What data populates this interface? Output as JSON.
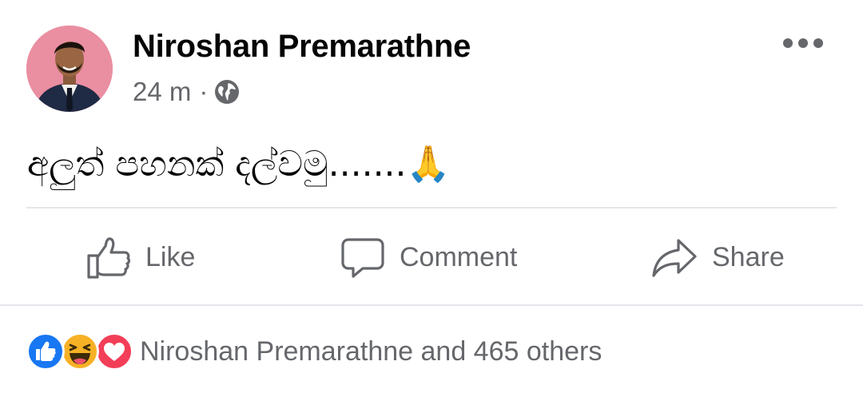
{
  "post": {
    "author": "Niroshan Premarathne",
    "time": "24 m",
    "separator": "·",
    "audience_icon": "globe-icon",
    "text": "අලුත් පහනක් දල්වමු.......",
    "emoji": "🙏"
  },
  "actions": {
    "like": "Like",
    "comment": "Comment",
    "share": "Share"
  },
  "reactions": {
    "icons": [
      "like-reaction-icon",
      "haha-reaction-icon",
      "love-reaction-icon"
    ],
    "summary": "Niroshan Premarathne and 465 others"
  },
  "colors": {
    "text_primary": "#050505",
    "text_secondary": "#65676b",
    "like_blue": "#1877f2",
    "love_red": "#f33e58",
    "haha_yellow": "#f7b125",
    "divider": "#e4e6eb"
  }
}
